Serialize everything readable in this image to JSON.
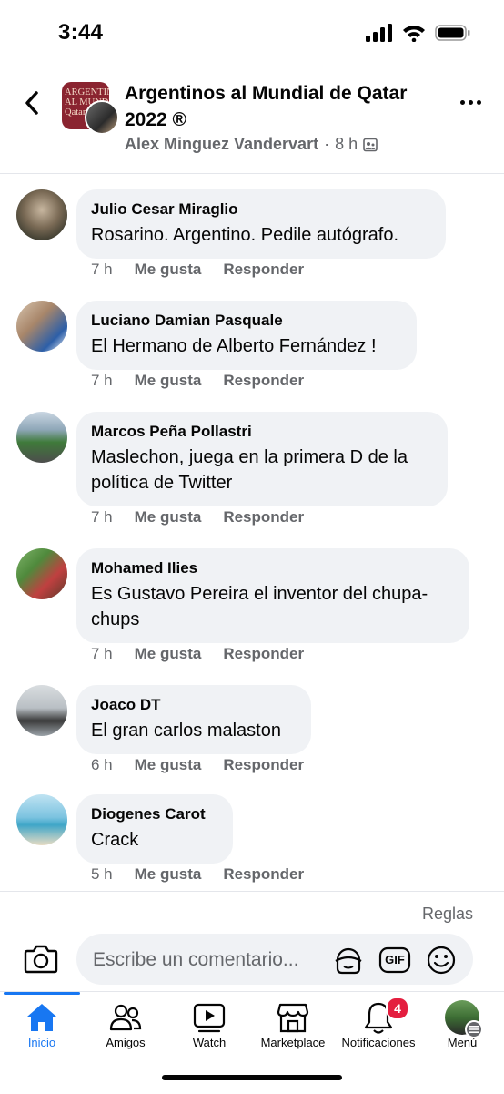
{
  "status": {
    "time": "3:44"
  },
  "header": {
    "group_name": "Argentinos al Mundial de Qatar 2022 ®",
    "group_avatar_text": "ARGENTINOS\nAL MUNDIAL\nQatar",
    "poster": "Alex Minguez Vandervart",
    "dot": "·",
    "age": "8 h",
    "privacy_icon": "group-members-icon"
  },
  "comments": [
    {
      "author": "Julio Cesar Miraglio",
      "text": "Rosarino. Argentino.  Pedile autógrafo.",
      "age": "7 h",
      "like": "Me gusta",
      "reply": "Responder"
    },
    {
      "author": "Luciano Damian Pasquale",
      "text": "El Hermano de Alberto Fernández !",
      "age": "7 h",
      "like": "Me gusta",
      "reply": "Responder"
    },
    {
      "author": "Marcos Peña Pollastri",
      "text": "Maslechon, juega en la primera D de la política de Twitter",
      "age": "7 h",
      "like": "Me gusta",
      "reply": "Responder"
    },
    {
      "author": "Mohamed Ilies",
      "text": "Es Gustavo Pereira el inventor del chupa-chups",
      "age": "7 h",
      "like": "Me gusta",
      "reply": "Responder"
    },
    {
      "author": "Joaco DT",
      "text": "El gran carlos malaston",
      "age": "6 h",
      "like": "Me gusta",
      "reply": "Responder"
    },
    {
      "author": "Diogenes Carot",
      "text": "Crack",
      "age": "5 h",
      "like": "Me gusta",
      "reply": "Responder"
    }
  ],
  "composer": {
    "rules": "Reglas",
    "placeholder": "Escribe un comentario...",
    "gif": "GIF"
  },
  "tabs": [
    {
      "label": "Inicio",
      "icon": "home-icon",
      "active": true
    },
    {
      "label": "Amigos",
      "icon": "friends-icon"
    },
    {
      "label": "Watch",
      "icon": "watch-icon"
    },
    {
      "label": "Marketplace",
      "icon": "marketplace-icon"
    },
    {
      "label": "Notificaciones",
      "icon": "bell-icon",
      "badge": "4"
    },
    {
      "label": "Menú",
      "icon": "menu-avatar"
    }
  ],
  "colors": {
    "accent": "#1877f2",
    "badge": "#e41e3f",
    "bubble": "#f0f2f5",
    "secondary_text": "#65676b"
  }
}
